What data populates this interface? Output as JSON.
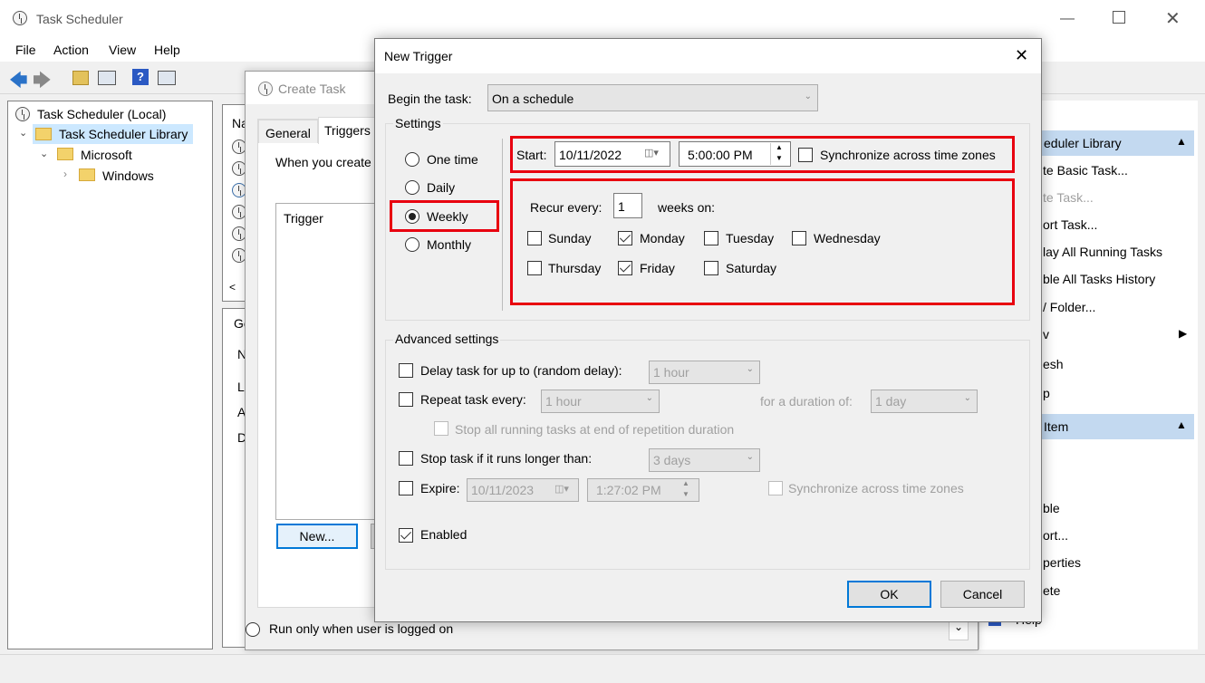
{
  "app": {
    "title": "Task Scheduler",
    "menu": [
      "File",
      "Action",
      "View",
      "Help"
    ]
  },
  "tree": {
    "root": "Task Scheduler (Local)",
    "library": "Task Scheduler Library",
    "microsoft": "Microsoft",
    "windows": "Windows"
  },
  "middle": {
    "header_partial": "Na",
    "tab_partial": "Ge",
    "list_partials": [
      "N",
      "L",
      "A",
      "D"
    ],
    "scroll_left": "<"
  },
  "actions": {
    "header1": "eduler Library",
    "items": [
      "te Basic Task...",
      "te Task...",
      "ort Task...",
      "lay All Running Tasks",
      "ble All Tasks History",
      "/ Folder...",
      "v",
      "esh",
      "p"
    ],
    "header2": "Item",
    "items2": [
      "ble",
      "ort...",
      "perties",
      "ete",
      "Help"
    ]
  },
  "create_task": {
    "title": "Create Task",
    "tabs": [
      "General",
      "Triggers"
    ],
    "intro": "When you create",
    "list_header": "Trigger",
    "new_btn": "New...",
    "run_only": "Run only when user is logged on"
  },
  "dialog": {
    "title": "New Trigger",
    "begin_label": "Begin the task:",
    "begin_value": "On a schedule",
    "settings_label": "Settings",
    "schedule_options": [
      "One time",
      "Daily",
      "Weekly",
      "Monthly"
    ],
    "selected_schedule": "Weekly",
    "start_label": "Start:",
    "start_date": "10/11/2022",
    "start_time": "5:00:00 PM",
    "sync_label": "Synchronize across time zones",
    "recur_label": "Recur every:",
    "recur_value": "1",
    "weeks_on": "weeks on:",
    "days": [
      {
        "name": "Sunday",
        "checked": false
      },
      {
        "name": "Monday",
        "checked": true
      },
      {
        "name": "Tuesday",
        "checked": false
      },
      {
        "name": "Wednesday",
        "checked": false
      },
      {
        "name": "Thursday",
        "checked": false
      },
      {
        "name": "Friday",
        "checked": true
      },
      {
        "name": "Saturday",
        "checked": false
      }
    ],
    "advanced_label": "Advanced settings",
    "delay_label": "Delay task for up to (random delay):",
    "delay_value": "1 hour",
    "repeat_label": "Repeat task every:",
    "repeat_value": "1 hour",
    "duration_label": "for a duration of:",
    "duration_value": "1 day",
    "stop_all_label": "Stop all running tasks at end of repetition duration",
    "stop_longer_label": "Stop task if it runs longer than:",
    "stop_longer_value": "3 days",
    "expire_label": "Expire:",
    "expire_date": "10/11/2023",
    "expire_time": "1:27:02 PM",
    "expire_sync_label": "Synchronize across time zones",
    "enabled_label": "Enabled",
    "enabled": true,
    "ok": "OK",
    "cancel": "Cancel"
  },
  "colors": {
    "highlight": "#e8000f",
    "selection": "#cce8ff",
    "action_header": "#c3d9f0",
    "ok_border": "#0078d7"
  }
}
